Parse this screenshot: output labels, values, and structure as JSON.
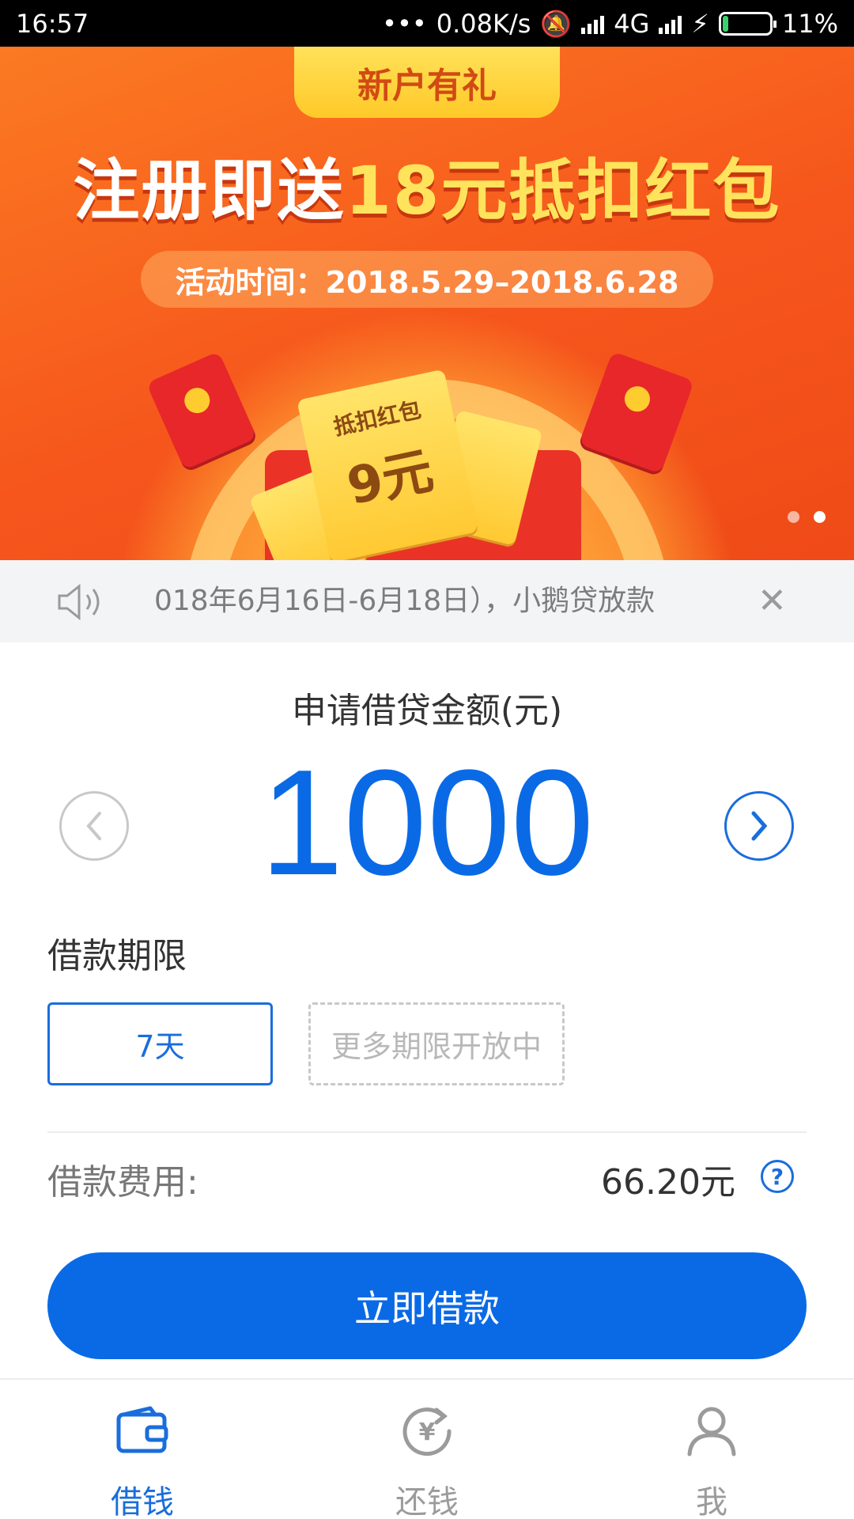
{
  "status_bar": {
    "time": "16:57",
    "speed": "0.08K/s",
    "network": "4G",
    "battery_percent": "11%",
    "battery_level": 0.11
  },
  "banner": {
    "tag": "新户有礼",
    "title_part1": "注册即送",
    "title_part2": "18元抵扣红包",
    "activity_time": "活动时间：2018.5.29–2018.6.28",
    "ticket_label": "抵扣红包",
    "ticket_value": "9元",
    "page_count": 2,
    "active_page": 2,
    "accent_color": "#ffe35c"
  },
  "notice": {
    "text": "018年6月16日-6月18日），小鹅贷放款",
    "close_label": "✕"
  },
  "loan": {
    "amount_title": "申请借贷金额(元)",
    "amount": "1000",
    "term_title": "借款期限",
    "term_options": [
      "7天",
      "更多期限开放中"
    ],
    "selected_term": "7天",
    "fee_label": "借款费用:",
    "fee_value": "66.20元",
    "help_label": "?",
    "submit_label": "立即借款",
    "primary_color": "#0a6ae6"
  },
  "bottom_nav": {
    "items": [
      {
        "label": "借钱",
        "icon": "wallet-icon",
        "active": true
      },
      {
        "label": "还钱",
        "icon": "repay-icon",
        "active": false
      },
      {
        "label": "我",
        "icon": "user-icon",
        "active": false
      }
    ]
  }
}
